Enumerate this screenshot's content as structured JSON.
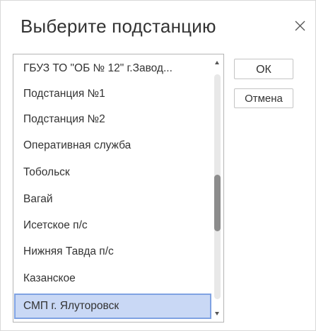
{
  "dialog": {
    "title": "Выберите подстанцию",
    "close_icon": "close-icon",
    "ok_label": "ОК",
    "cancel_label": "Отмена"
  },
  "list": {
    "items": [
      "ГБУЗ ТО \"ОБ № 12\" г.Завод...",
      "Подстанция №1",
      "Подстанция №2",
      "Оперативная служба",
      "Тобольск",
      "Вагай",
      "Исетское п/с",
      "Нижняя Тавда п/с",
      "Казанское",
      "СМП г. Ялуторовск"
    ],
    "selected_index": 9,
    "scroll_position": 0.55
  },
  "colors": {
    "selection_bg": "#c9d8f5",
    "selection_border": "#7fa2e2",
    "text": "#333333"
  }
}
